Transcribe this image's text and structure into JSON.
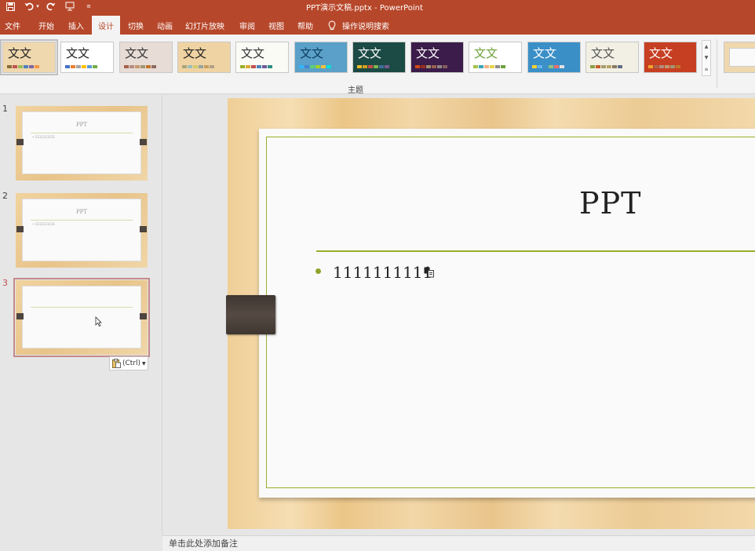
{
  "window": {
    "title": "PPT演示文稿.pptx  -  PowerPoint"
  },
  "tabs": [
    "文件",
    "开始",
    "插入",
    "设计",
    "切换",
    "动画",
    "幻灯片放映",
    "审阅",
    "视图",
    "帮助"
  ],
  "active_tab": "设计",
  "tell_me": "操作说明搜索",
  "ribbon": {
    "group_label": "主题",
    "theme_sample_text": "文文",
    "themes": [
      {
        "bg": "#f0d8ae",
        "fg": "#222",
        "swatches": [
          "#8a6a3a",
          "#c0504d",
          "#9bbb59",
          "#4f81bd",
          "#8064a2",
          "#f79646"
        ]
      },
      {
        "bg": "#ffffff",
        "fg": "#222",
        "swatches": [
          "#4472c4",
          "#ed7d31",
          "#a5a5a5",
          "#ffc000",
          "#5b9bd5",
          "#70ad47"
        ]
      },
      {
        "bg": "#e8dcd6",
        "fg": "#333",
        "swatches": [
          "#a5644e",
          "#b58b80",
          "#c3986d",
          "#a19574",
          "#c17529",
          "#8e6b61"
        ]
      },
      {
        "bg": "#f0d3a3",
        "fg": "#222",
        "swatches": [
          "#a9a57c",
          "#9cbebd",
          "#d2cb6c",
          "#95a39d",
          "#c89f5d",
          "#b1a089"
        ]
      },
      {
        "bg": "#fbfbf6",
        "fg": "#333",
        "swatches": [
          "#9bad2b",
          "#e0a832",
          "#c0504d",
          "#4f81bd",
          "#6e5c9b",
          "#2f8d83"
        ]
      },
      {
        "bg": "#5aa0c8",
        "fg": "#0c3d5e",
        "swatches": [
          "#31b6fd",
          "#4584d3",
          "#5bd078",
          "#a5d028",
          "#f5c040",
          "#05e0db"
        ]
      },
      {
        "bg": "#1c4a44",
        "fg": "#ffffff",
        "swatches": [
          "#e7bc29",
          "#d0a020",
          "#c64f4a",
          "#7fb44d",
          "#3f6f99",
          "#7a5a92"
        ]
      },
      {
        "bg": "#3b1c4a",
        "fg": "#ffffff",
        "swatches": [
          "#d34817",
          "#9b2d1f",
          "#a28e6a",
          "#956251",
          "#918485",
          "#855d5d"
        ]
      },
      {
        "bg": "#ffffff",
        "fg": "#6ea13a",
        "swatches": [
          "#a5c249",
          "#3aa5b5",
          "#f4b183",
          "#e7d44b",
          "#8c8c8c",
          "#6ea13a"
        ]
      },
      {
        "bg": "#3b8fc7",
        "fg": "#ffffff",
        "swatches": [
          "#fdd033",
          "#67b5ec",
          "#3e91c8",
          "#93c47d",
          "#f16e6e",
          "#e2e2e2"
        ]
      },
      {
        "bg": "#f2f0e4",
        "fg": "#555",
        "swatches": [
          "#8aa048",
          "#c75d2c",
          "#a59d6e",
          "#b8a36a",
          "#8a7a64",
          "#606e86"
        ]
      },
      {
        "bg": "#c73f22",
        "fg": "#ffffff",
        "swatches": [
          "#f0a22e",
          "#a5644e",
          "#b58b80",
          "#c3986d",
          "#a19574",
          "#c17529"
        ]
      }
    ]
  },
  "slides": [
    {
      "number": "1",
      "title": "PPT",
      "bullet": "• 1111111111"
    },
    {
      "number": "2",
      "title": "PPT",
      "bullet": "• 1111111111"
    },
    {
      "number": "3",
      "title": "",
      "bullet": ""
    }
  ],
  "active_slide": "3",
  "paste_options": {
    "label": "(Ctrl)"
  },
  "main_slide": {
    "title": "PPT",
    "bullet": "1111111111"
  },
  "notes_placeholder": "单击此处添加备注",
  "colors": {
    "accent": "#b7472a",
    "slide_rule": "#9bad2b"
  }
}
